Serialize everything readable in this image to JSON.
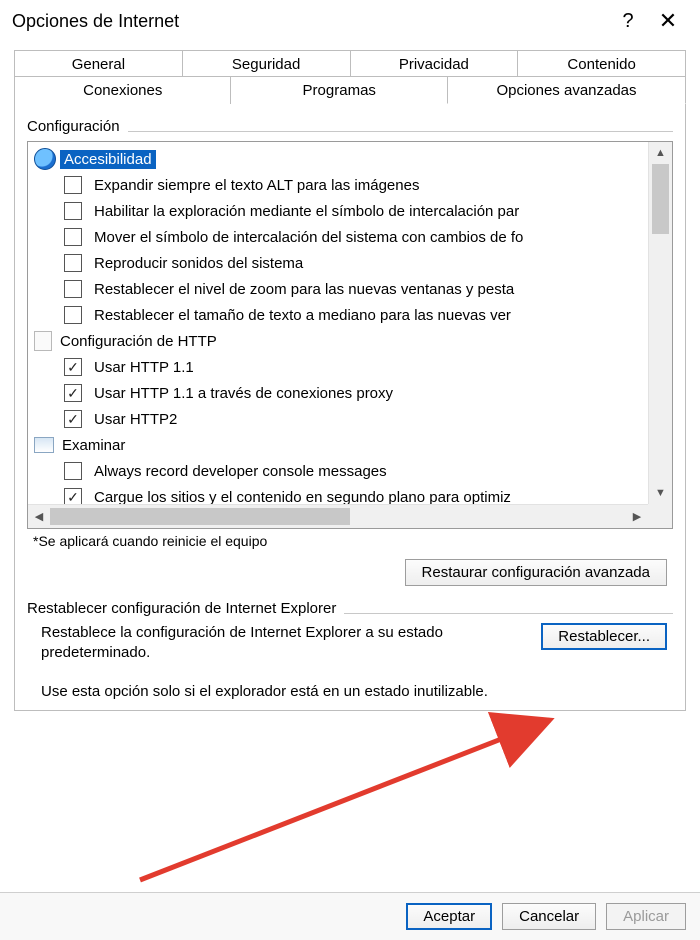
{
  "window": {
    "title": "Opciones de Internet"
  },
  "tabs": {
    "row1": [
      "General",
      "Seguridad",
      "Privacidad",
      "Contenido"
    ],
    "row2": [
      "Conexiones",
      "Programas",
      "Opciones avanzadas"
    ],
    "active": "Opciones avanzadas"
  },
  "settings_group_label": "Configuración",
  "tree": {
    "cat_accessibility": "Accesibilidad",
    "acc_items": [
      "Expandir siempre el texto ALT para las imágenes",
      "Habilitar la exploración mediante el símbolo de intercalación par",
      "Mover el símbolo de intercalación del sistema con cambios de fo",
      "Reproducir sonidos del sistema",
      "Restablecer el nivel de zoom para las nuevas ventanas y pesta",
      "Restablecer el tamaño de texto a mediano para las nuevas ver"
    ],
    "cat_http": "Configuración de HTTP",
    "http_items": [
      "Usar HTTP 1.1",
      "Usar HTTP 1.1 a través de conexiones proxy",
      "Usar HTTP2"
    ],
    "cat_examine": "Examinar",
    "exam_items": [
      "Always record developer console messages",
      "Cargue los sitios y el contenido en segundo plano para optimiz"
    ]
  },
  "restart_note": "*Se aplicará cuando reinicie el equipo",
  "restore_button": "Restaurar configuración avanzada",
  "reset_group_label": "Restablecer configuración de Internet Explorer",
  "reset_text": "Restablece la configuración de Internet Explorer a su estado predeterminado.",
  "reset_button": "Restablecer...",
  "reset_warning": "Use esta opción solo si el explorador está en un estado inutilizable.",
  "footer": {
    "ok": "Aceptar",
    "cancel": "Cancelar",
    "apply": "Aplicar"
  }
}
